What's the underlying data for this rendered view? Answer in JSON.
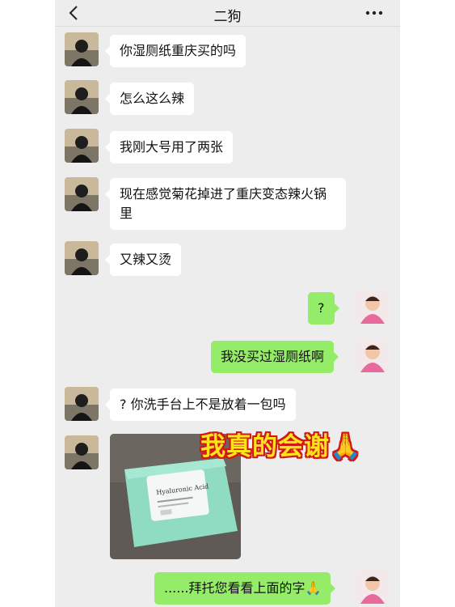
{
  "header": {
    "title": "二狗"
  },
  "messages": [
    {
      "side": "left",
      "text": "你湿厕纸重庆买的吗"
    },
    {
      "side": "left",
      "text": "怎么这么辣"
    },
    {
      "side": "left",
      "text": "我刚大号用了两张"
    },
    {
      "side": "left",
      "text": "现在感觉菊花掉进了重庆变态辣火锅里"
    },
    {
      "side": "left",
      "text": "又辣又烫"
    },
    {
      "side": "right",
      "text": "?"
    },
    {
      "side": "right",
      "text": "我没买过湿厕纸啊"
    },
    {
      "side": "left",
      "text": "? 你洗手台上不是放着一包吗"
    },
    {
      "side": "left",
      "type": "image",
      "image_text": [
        "Hyaluronic Acid"
      ]
    },
    {
      "side": "right",
      "text": "......拜托您看看上面的字🙏"
    }
  ],
  "overlay_caption": "我真的会谢🙏",
  "colors": {
    "background": "#ededed",
    "bubble_self": "#95ec69",
    "bubble_other": "#ffffff",
    "caption_fill": "#ffe31a",
    "caption_outline": "#d01818"
  },
  "icons": {
    "back": "chevron-left-icon",
    "more": "more-dots-icon"
  }
}
